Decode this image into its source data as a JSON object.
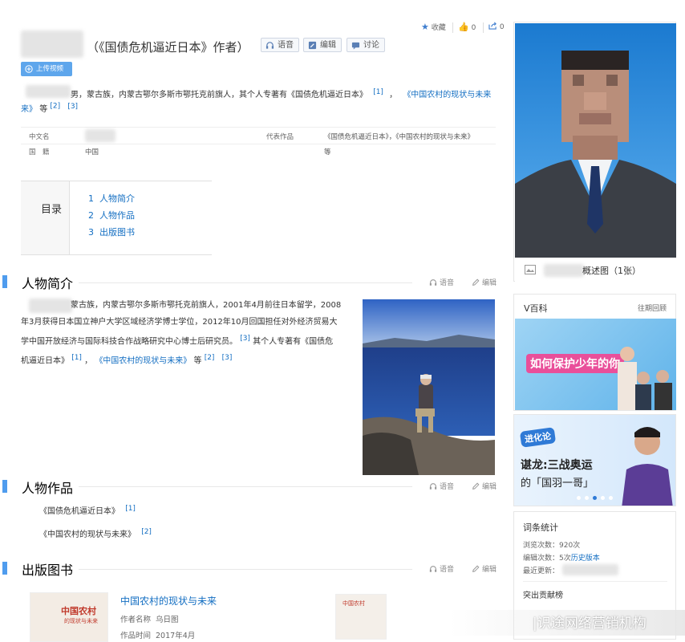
{
  "header": {
    "title_suffix": "（《国债危机逼近日本》作者）",
    "voice_label": "语音",
    "edit_label": "编辑",
    "discuss_label": "讨论",
    "upload_video_label": "上传视频",
    "favorite_label": "收藏",
    "like_count": "0",
    "share_count": "0"
  },
  "summary": {
    "text": "男，蒙古族，内蒙古鄂尔多斯市鄂托克前旗人，其个人专著有《国债危机逼近日本》",
    "ref1": "[1]",
    "sep": "，",
    "book2_link": "《中国农村的现状与未来",
    "book2_tail": "来》",
    "tail": "等",
    "ref2": "[2]",
    "ref3": "[3]"
  },
  "infobox": {
    "rows": [
      {
        "label": "中文名",
        "value": "",
        "label2": "代表作品",
        "value2": "《国债危机逼近日本》，《中国农村的现状与未来》"
      },
      {
        "label": "国　籍",
        "value": "中国",
        "label2": "",
        "value2": "等"
      }
    ]
  },
  "toc": {
    "label": "目录",
    "items": [
      {
        "num": "1",
        "label": "人物简介"
      },
      {
        "num": "2",
        "label": "人物作品"
      },
      {
        "num": "3",
        "label": "出版图书"
      }
    ]
  },
  "sections": {
    "bio_title": "人物简介",
    "works_title": "人物作品",
    "books_title": "出版图书",
    "voice_label": "语音",
    "edit_label": "编辑"
  },
  "bio": {
    "line1": "蒙古族，内蒙古鄂尔多斯市鄂托克前旗人，2001年4月前往日本留学，2008",
    "line2": "年3月获得日本国立神户大学区域经济学博士学位，2012年10月回国担任对外经济贸易大",
    "line3": "学中国开放经济与国际科技合作战略研究中心博士后研究员。",
    "line3_ref": "[3]",
    "line3_tail": "其个人专著有《国债危",
    "line4": "机逼近日本》",
    "ref1": "[1]",
    "sep": "，",
    "link": "《中国农村的现状与未来》",
    "tail": "等",
    "ref2": "[2]",
    "ref3": "[3]"
  },
  "works": [
    {
      "title": "《国债危机逼近日本》",
      "ref": "[1]"
    },
    {
      "title": "《中国农村的现状与未来》",
      "ref": "[2]"
    }
  ],
  "book": {
    "title": "中国农村的现状与未来",
    "author_label": "作者名称",
    "author": "乌日图",
    "time_label": "作品时间",
    "time": "2017年4月",
    "cover_text1": "中国农村",
    "cover_text2": "的现状与未来",
    "cover2_text": "中国农村"
  },
  "sidebar": {
    "album_label": "概述图（1张）",
    "vbaike_title": "V百科",
    "vbaike_more": "往期回顾",
    "banner1_text": "如何保护少年的你",
    "banner2_tag": "进化论",
    "banner2_title": "谌龙:三战奥运",
    "banner2_sub": "的「国羽一哥」",
    "stats_title": "词条统计",
    "views": "浏览次数：920次",
    "edits_prefix": "编辑次数：5次",
    "edits_link": "历史版本",
    "recent": "最近更新：",
    "contrib_title": "突出贡献榜"
  },
  "watermark": "|识途网络营销机构"
}
